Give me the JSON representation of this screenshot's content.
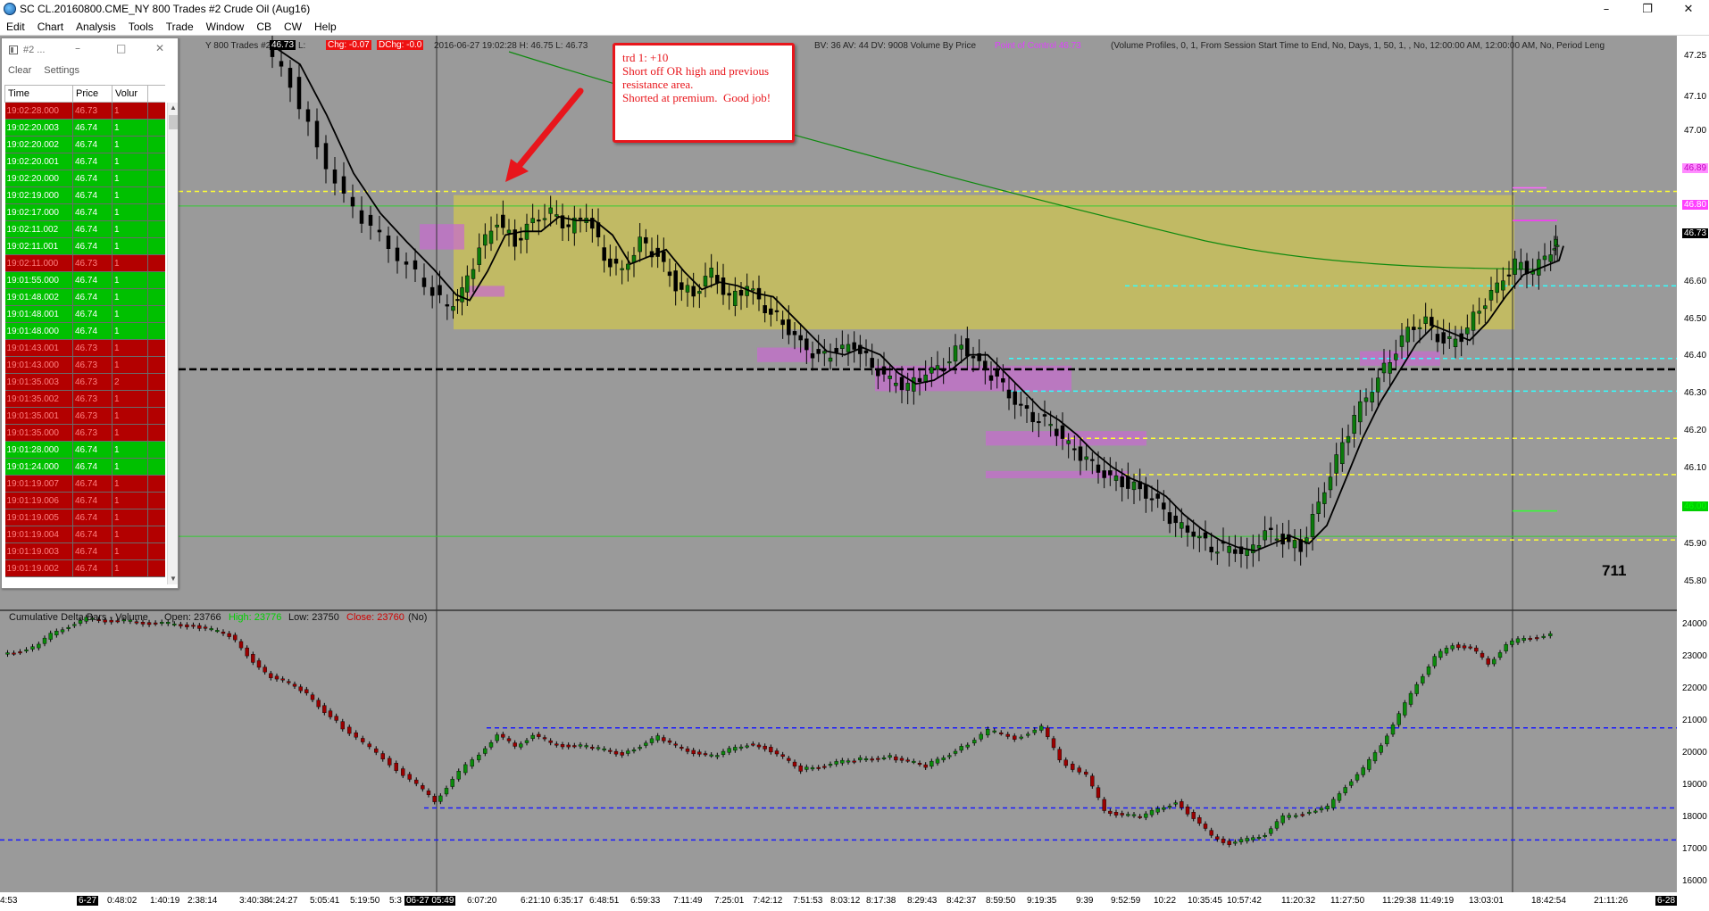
{
  "window": {
    "title": "SC CL.20160800.CME_NY  800 Trades  #2  Crude Oil (Aug16)",
    "minimize": "–",
    "restore": "❐",
    "close": "✕"
  },
  "menu": [
    "Edit",
    "Chart",
    "Analysis",
    "Tools",
    "Trade",
    "Window",
    "CB",
    "CW",
    "Help"
  ],
  "chart_header": {
    "left_text": "Y 800 Trades #2",
    "price_box": "46.73",
    "field1": "L:",
    "chg1": "Chg: -0.07",
    "chg2": "DChg: -0.0",
    "info_text": "2016-06-27 19:02:28  H: 46.75  L: 46.73",
    "right_text": "BV: 36  AV: 44  DV: 9008  Volume By Price",
    "poc_text": "Point of Control 46.73",
    "profile_text": "(Volume Profiles, 0, 1, From Session Start Time to End, No, Days, 1, 50, 1, , No, 12:00:00 AM, 12:00:00 AM, No, Period Leng"
  },
  "ts_window": {
    "title": "#2 ...",
    "menu": [
      "Clear",
      "Settings"
    ],
    "columns": [
      "Time",
      "Price",
      "Volur"
    ],
    "rows": [
      {
        "time": "19:02:28.000",
        "price": "46.73",
        "vol": "1",
        "side": "sell"
      },
      {
        "time": "19:02:20.003",
        "price": "46.74",
        "vol": "1",
        "side": "buy"
      },
      {
        "time": "19:02:20.002",
        "price": "46.74",
        "vol": "1",
        "side": "buy"
      },
      {
        "time": "19:02:20.001",
        "price": "46.74",
        "vol": "1",
        "side": "buy"
      },
      {
        "time": "19:02:20.000",
        "price": "46.74",
        "vol": "1",
        "side": "buy"
      },
      {
        "time": "19:02:19.000",
        "price": "46.74",
        "vol": "1",
        "side": "buy"
      },
      {
        "time": "19:02:17.000",
        "price": "46.74",
        "vol": "1",
        "side": "buy"
      },
      {
        "time": "19:02:11.002",
        "price": "46.74",
        "vol": "1",
        "side": "buy"
      },
      {
        "time": "19:02:11.001",
        "price": "46.74",
        "vol": "1",
        "side": "buy"
      },
      {
        "time": "19:02:11.000",
        "price": "46.73",
        "vol": "1",
        "side": "sell"
      },
      {
        "time": "19:01:55.000",
        "price": "46.74",
        "vol": "1",
        "side": "buy"
      },
      {
        "time": "19:01:48.002",
        "price": "46.74",
        "vol": "1",
        "side": "buy"
      },
      {
        "time": "19:01:48.001",
        "price": "46.74",
        "vol": "1",
        "side": "buy"
      },
      {
        "time": "19:01:48.000",
        "price": "46.74",
        "vol": "1",
        "side": "buy"
      },
      {
        "time": "19:01:43.001",
        "price": "46.73",
        "vol": "1",
        "side": "sell"
      },
      {
        "time": "19:01:43.000",
        "price": "46.73",
        "vol": "1",
        "side": "sell"
      },
      {
        "time": "19:01:35.003",
        "price": "46.73",
        "vol": "2",
        "side": "sell"
      },
      {
        "time": "19:01:35.002",
        "price": "46.73",
        "vol": "1",
        "side": "sell"
      },
      {
        "time": "19:01:35.001",
        "price": "46.73",
        "vol": "1",
        "side": "sell"
      },
      {
        "time": "19:01:35.000",
        "price": "46.73",
        "vol": "1",
        "side": "sell"
      },
      {
        "time": "19:01:28.000",
        "price": "46.74",
        "vol": "1",
        "side": "buy"
      },
      {
        "time": "19:01:24.000",
        "price": "46.74",
        "vol": "1",
        "side": "buy"
      },
      {
        "time": "19:01:19.007",
        "price": "46.74",
        "vol": "1",
        "side": "sell"
      },
      {
        "time": "19:01:19.006",
        "price": "46.74",
        "vol": "1",
        "side": "sell"
      },
      {
        "time": "19:01:19.005",
        "price": "46.74",
        "vol": "1",
        "side": "sell"
      },
      {
        "time": "19:01:19.004",
        "price": "46.74",
        "vol": "1",
        "side": "sell"
      },
      {
        "time": "19:01:19.003",
        "price": "46.74",
        "vol": "1",
        "side": "sell"
      },
      {
        "time": "19:01:19.002",
        "price": "46.74",
        "vol": "1",
        "side": "sell"
      }
    ]
  },
  "annotation": {
    "line1": "trd 1: +10",
    "line2": "Short off OR high and previous resistance area.",
    "line3": "Shorted at premium.  Good job!"
  },
  "main_chart": {
    "price_labels": [
      "47.25",
      "47.10",
      "47.00",
      "46.89",
      "46.80",
      "46.73",
      "46.60",
      "46.50",
      "46.40",
      "46.30",
      "46.20",
      "46.10",
      "46.00",
      "45.90",
      "45.80"
    ],
    "last_price": "46.73",
    "tag_high": "46.89",
    "tag_pink": "46.80",
    "tag_green": "46.00",
    "bar_count": "711",
    "colors": {
      "bg": "#9a9a9a",
      "ma": "#000000",
      "long_ma": "#0f8a0f",
      "or_box": "#c8bf5a",
      "vp_pink": "#c86ad0",
      "yellow_line": "#ffff33",
      "cyan_line": "#33ffff",
      "poc_line": "#000000"
    }
  },
  "delta_chart": {
    "header_label": "Cumulative Delta Bars - Volume",
    "open": "Open: 23766",
    "high": "High: 23776",
    "low": "Low: 23750",
    "close": "Close: 23760",
    "flag": "(No)",
    "price_labels": [
      "24000",
      "23000",
      "22000",
      "21000",
      "20000",
      "19000",
      "18000",
      "17000",
      "16000"
    ]
  },
  "time_axis": {
    "labels": [
      "4:53",
      "6-27",
      "0:48:02",
      "1:40:19",
      "2:38:14",
      "3:40:38",
      "4:24:27",
      "5:05:41",
      "5:19:50",
      "5:3",
      "06-27 05:49",
      "6:07:20",
      "6:21:10",
      "6:35:17",
      "6:48:51",
      "6:59:33",
      "7:11:49",
      "7:25:01",
      "7:42:12",
      "7:51:53",
      "8:03:12",
      "8:17:38",
      "8:29:43",
      "8:42:37",
      "8:59:50",
      "9:19:35",
      "9:39",
      "9:52:59",
      "10:22",
      "10:35:45",
      "10:57:42",
      "11:20:32",
      "11:27:50",
      "11:29:38",
      "11:49:19",
      "13:03:01",
      "18:42:54",
      "21:11:26",
      "6-28"
    ]
  }
}
